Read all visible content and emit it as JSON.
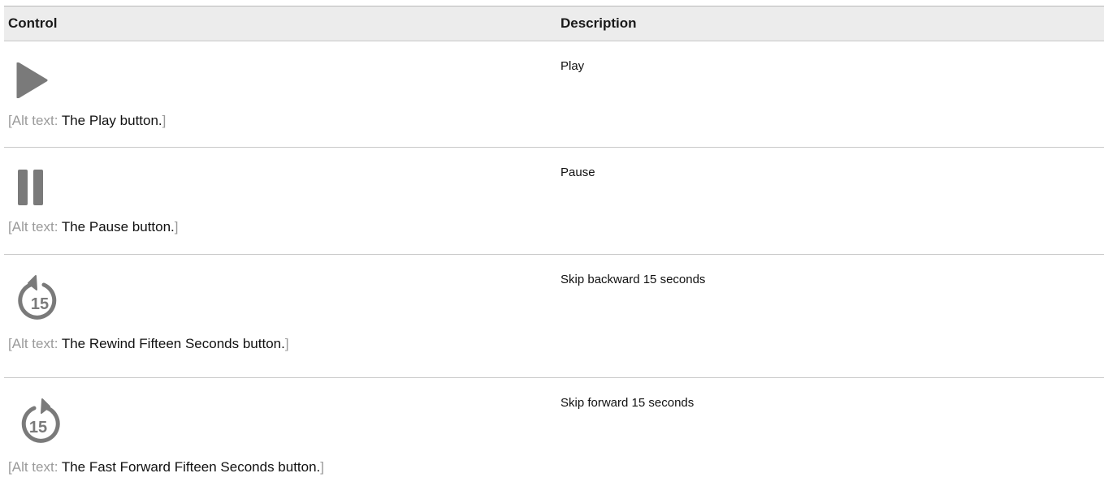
{
  "table": {
    "headers": {
      "control": "Control",
      "description": "Description"
    },
    "rows": [
      {
        "icon": "play-icon",
        "alt_open": "[",
        "alt_label": "Alt text: ",
        "alt_value": "The Play button.",
        "alt_close": "]",
        "description": "Play"
      },
      {
        "icon": "pause-icon",
        "alt_open": "[",
        "alt_label": "Alt text: ",
        "alt_value": "The Pause button.",
        "alt_close": "]",
        "description": "Pause"
      },
      {
        "icon": "rewind-15-icon",
        "icon_text": "15",
        "alt_open": "[",
        "alt_label": "Alt text: ",
        "alt_value": "The Rewind Fifteen Seconds button.",
        "alt_close": "]",
        "description": "Skip backward 15 seconds"
      },
      {
        "icon": "fast-forward-15-icon",
        "icon_text": "15",
        "alt_open": "[",
        "alt_label": "Alt text: ",
        "alt_value": "The Fast Forward Fifteen Seconds button.",
        "alt_close": "]",
        "description": "Skip forward 15 seconds"
      }
    ]
  },
  "colors": {
    "icon_gray": "#7a7a7a",
    "header_bg": "#ececec",
    "alt_text_gray": "#9a9a9a"
  }
}
